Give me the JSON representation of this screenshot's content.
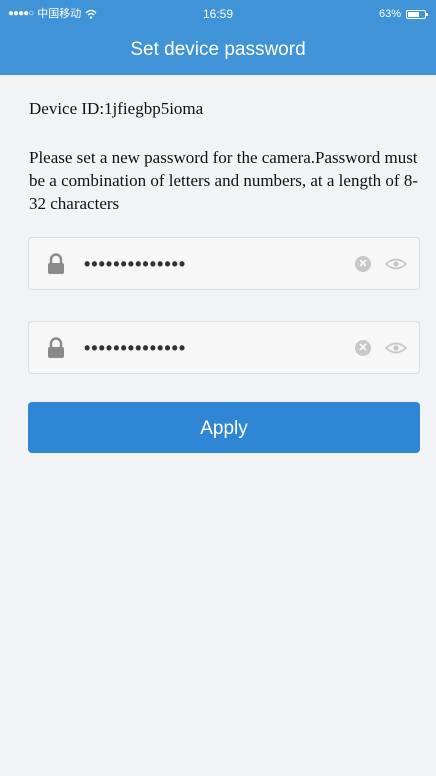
{
  "statusbar": {
    "carrier": "中国移动",
    "time": "16:59",
    "battery": "63%"
  },
  "header": {
    "title": "Set device password"
  },
  "device": {
    "id_text": "Device ID:1jfiegbp5ioma"
  },
  "instructions": "Please set a new password for the camera.Password must be a combination of letters and numbers, at a length of 8-32 characters",
  "password_field": {
    "value": "••••••••••••••"
  },
  "confirm_field": {
    "value": "••••••••••••••"
  },
  "apply_label": "Apply",
  "colors": {
    "header": "#3f93d6",
    "button": "#2f86d4",
    "background": "#f2f3f5"
  }
}
